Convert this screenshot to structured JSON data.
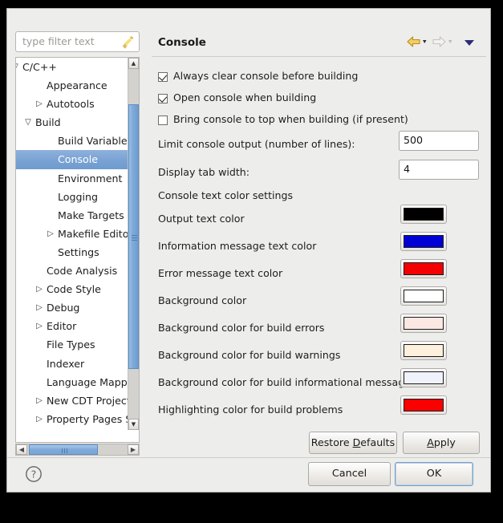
{
  "dialog": {
    "title": "Console"
  },
  "filter": {
    "placeholder": "type filter text",
    "value": "",
    "clear_icon": "broom-icon"
  },
  "tree": {
    "items": [
      {
        "label": "C/C++",
        "indent": 8,
        "twisty": "expanded",
        "selected": false
      },
      {
        "label": "Appearance",
        "indent": 38,
        "twisty": "none",
        "selected": false
      },
      {
        "label": "Autotools",
        "indent": 38,
        "twisty": "collapsed",
        "selected": false
      },
      {
        "label": "Build",
        "indent": 24,
        "twisty": "expanded",
        "selected": false
      },
      {
        "label": "Build Variables",
        "indent": 52,
        "twisty": "none",
        "selected": false
      },
      {
        "label": "Console",
        "indent": 52,
        "twisty": "none",
        "selected": true
      },
      {
        "label": "Environment",
        "indent": 52,
        "twisty": "none",
        "selected": false
      },
      {
        "label": "Logging",
        "indent": 52,
        "twisty": "none",
        "selected": false
      },
      {
        "label": "Make Targets",
        "indent": 52,
        "twisty": "none",
        "selected": false
      },
      {
        "label": "Makefile Editor",
        "indent": 52,
        "twisty": "collapsed",
        "selected": false
      },
      {
        "label": "Settings",
        "indent": 52,
        "twisty": "none",
        "selected": false
      },
      {
        "label": "Code Analysis",
        "indent": 38,
        "twisty": "none",
        "selected": false
      },
      {
        "label": "Code Style",
        "indent": 38,
        "twisty": "collapsed",
        "selected": false
      },
      {
        "label": "Debug",
        "indent": 38,
        "twisty": "collapsed",
        "selected": false
      },
      {
        "label": "Editor",
        "indent": 38,
        "twisty": "collapsed",
        "selected": false
      },
      {
        "label": "File Types",
        "indent": 38,
        "twisty": "none",
        "selected": false
      },
      {
        "label": "Indexer",
        "indent": 38,
        "twisty": "none",
        "selected": false
      },
      {
        "label": "Language Mappings",
        "indent": 38,
        "twisty": "none",
        "selected": false
      },
      {
        "label": "New CDT Project Wizard",
        "indent": 38,
        "twisty": "collapsed",
        "selected": false
      },
      {
        "label": "Property Pages Settings",
        "indent": 38,
        "twisty": "collapsed",
        "selected": false
      }
    ],
    "selection_color": "#7ba3d4",
    "scroll_thumb_color": "#7fa9d9"
  },
  "header": {
    "back_icon": "back-arrow-icon",
    "back_dropdown_icon": "chevron-down-icon",
    "forward_icon": "forward-arrow-icon",
    "forward_dropdown_icon": "chevron-down-icon",
    "menu_icon": "triangle-down-icon",
    "back_color": "#e0a63a",
    "forward_color": "#cfcdc9",
    "menu_color": "#2b2b7a"
  },
  "options": {
    "checkboxes": [
      {
        "label": "Always clear console before building",
        "checked": true
      },
      {
        "label": "Open console when building",
        "checked": true
      },
      {
        "label": "Bring console to top when building (if present)",
        "checked": false
      }
    ],
    "fields": [
      {
        "label": "Limit console output (number of lines):",
        "value": "500"
      },
      {
        "label": "Display tab width:",
        "value": "4"
      }
    ],
    "section_label": "Console text color settings",
    "colors": [
      {
        "label": "Output text color",
        "value": "#000000"
      },
      {
        "label": "Information message text color",
        "value": "#0000d5"
      },
      {
        "label": "Error message text color",
        "value": "#f50000"
      },
      {
        "label": "Background color",
        "value": "#ffffff"
      },
      {
        "label": "Background color for build errors",
        "value": "#fce8e2"
      },
      {
        "label": "Background color for build warnings",
        "value": "#fdf0dc"
      },
      {
        "label": "Background color for build informational messages",
        "value": "#f0f2fb"
      },
      {
        "label": "Highlighting color for build problems",
        "value": "#fa0000"
      }
    ]
  },
  "pane_buttons": {
    "restore_defaults_pre": "Restore ",
    "restore_defaults_mnemonic": "D",
    "restore_defaults_post": "efaults",
    "apply_mnemonic": "A",
    "apply_post": "pply"
  },
  "footer": {
    "help_icon": "help-icon",
    "cancel_label": "Cancel",
    "ok_label": "OK"
  }
}
